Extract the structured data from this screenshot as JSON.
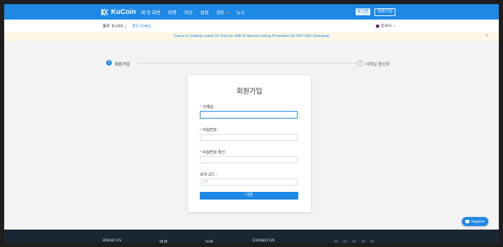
{
  "header": {
    "logo": "KuCoin",
    "nav": [
      "메 인 화면",
      "마켓",
      "자산",
      "설정",
      "검토",
      "뉴스"
    ],
    "login_label": "로그인",
    "signup_label": "회원가입",
    "accent": "#1e88e5"
  },
  "subbar": {
    "currency_label": "통화",
    "currency_value": "$ USD",
    "promo": "창도 (CAN)",
    "language": "한국어"
  },
  "banner": {
    "text": "Canya is Getting Listed On KuCoin With A Special Listing Promotion 50,000 CAN Giveaway",
    "close": "×"
  },
  "steps": [
    {
      "num": "1",
      "label": "회원가입"
    },
    {
      "num": "2",
      "label": "이메일 활성화"
    }
  ],
  "form": {
    "title": "회원가입",
    "email_label": "이메일 :",
    "password_label": "비밀번호 :",
    "confirm_label": "비밀번호 확인 :",
    "invite_label": "초대 코드 :",
    "invite_placeholder": "선택",
    "required_mark": "*",
    "submit_label": "다음"
  },
  "footer": {
    "links": [
      "About Us",
      "약관",
      "거래",
      "Contact Us"
    ]
  },
  "support": {
    "label": "Support"
  }
}
